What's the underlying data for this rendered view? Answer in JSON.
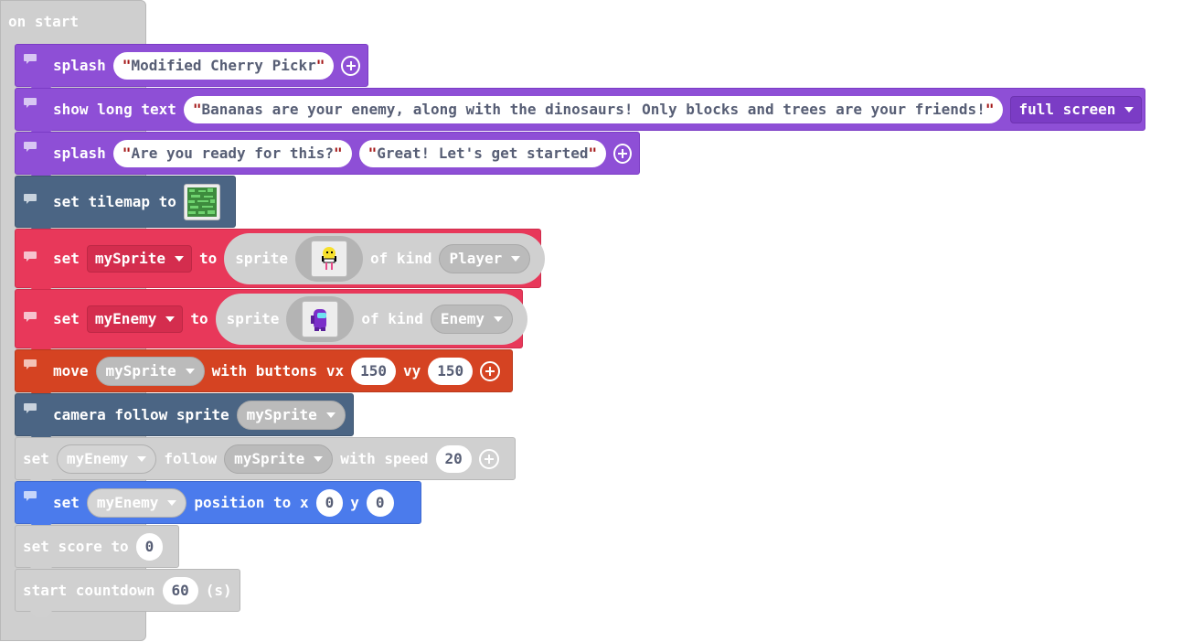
{
  "hat": {
    "label": "on start"
  },
  "b1": {
    "label": "splash",
    "text": "Modified Cherry Pickr"
  },
  "b2": {
    "label": "show long text",
    "text": "Bananas are your enemy, along with the dinosaurs! Only blocks and trees are your friends!",
    "mode": "full screen"
  },
  "b3": {
    "label": "splash",
    "text1": "Are you ready for this?",
    "text2": "Great! Let's get started"
  },
  "b4": {
    "label": "set tilemap to"
  },
  "b5": {
    "set": "set",
    "var": "mySprite",
    "to": "to",
    "sprite": "sprite",
    "of_kind": "of kind",
    "kind": "Player"
  },
  "b6": {
    "set": "set",
    "var": "myEnemy",
    "to": "to",
    "sprite": "sprite",
    "of_kind": "of kind",
    "kind": "Enemy"
  },
  "b7": {
    "move": "move",
    "var": "mySprite",
    "with": "with buttons vx",
    "vx": "150",
    "vy_label": "vy",
    "vy": "150"
  },
  "b8": {
    "label": "camera follow sprite",
    "var": "mySprite"
  },
  "b9": {
    "set": "set",
    "var1": "myEnemy",
    "follow": "follow",
    "var2": "mySprite",
    "with_speed": "with speed",
    "speed": "20"
  },
  "b10": {
    "set": "set",
    "var": "myEnemy",
    "position": "position to x",
    "x": "0",
    "y_label": "y",
    "y": "0"
  },
  "b11": {
    "label": "set score to",
    "value": "0"
  },
  "b12": {
    "label": "start countdown",
    "value": "60",
    "unit": "(s)"
  },
  "icons": {
    "comment": "comment-icon",
    "plus": "plus-circle-icon",
    "dropdown": "chevron-down-icon"
  },
  "colors": {
    "looks": "#8e4fd6",
    "scene": "#4b6584",
    "sprites": "#e8385a",
    "controller": "#d54322",
    "position": "#4b7bec",
    "disabled": "#d0d0d0"
  }
}
